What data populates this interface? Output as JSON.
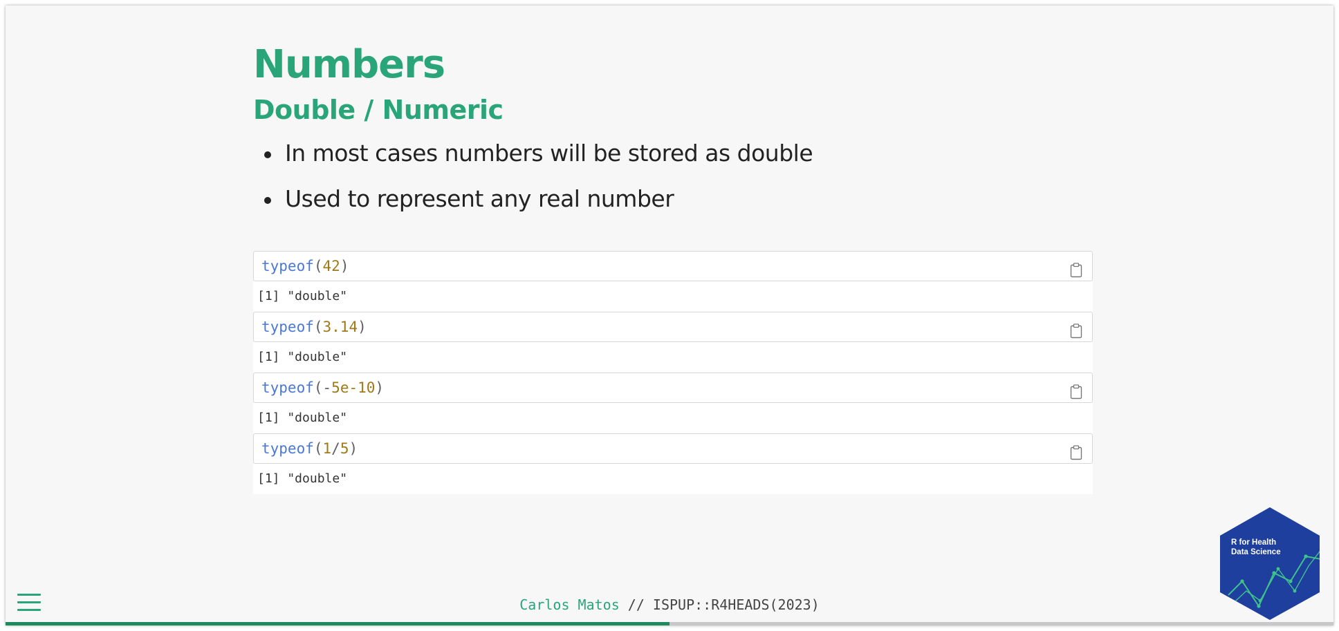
{
  "slide": {
    "title": "Numbers",
    "subtitle": "Double / Numeric",
    "bullets": [
      "In most cases numbers will be stored as double",
      "Used to represent any real number"
    ]
  },
  "code_blocks": [
    {
      "tokens": [
        {
          "type": "fn",
          "text": "typeof"
        },
        {
          "type": "op",
          "text": "("
        },
        {
          "type": "num",
          "text": "42"
        },
        {
          "type": "op",
          "text": ")"
        }
      ],
      "output": "[1] \"double\""
    },
    {
      "tokens": [
        {
          "type": "fn",
          "text": "typeof"
        },
        {
          "type": "op",
          "text": "("
        },
        {
          "type": "num",
          "text": "3.14"
        },
        {
          "type": "op",
          "text": ")"
        }
      ],
      "output": "[1] \"double\""
    },
    {
      "tokens": [
        {
          "type": "fn",
          "text": "typeof"
        },
        {
          "type": "op",
          "text": "("
        },
        {
          "type": "op",
          "text": "-"
        },
        {
          "type": "num",
          "text": "5e-10"
        },
        {
          "type": "op",
          "text": ")"
        }
      ],
      "output": "[1] \"double\""
    },
    {
      "tokens": [
        {
          "type": "fn",
          "text": "typeof"
        },
        {
          "type": "op",
          "text": "("
        },
        {
          "type": "num",
          "text": "1"
        },
        {
          "type": "op",
          "text": "/"
        },
        {
          "type": "num",
          "text": "5"
        },
        {
          "type": "op",
          "text": ")"
        }
      ],
      "output": "[1] \"double\""
    }
  ],
  "copy_icon": "clipboard-icon",
  "logo": {
    "line1": "R for Health",
    "line2": "Data Science",
    "color": "#1f3f9e"
  },
  "footer": {
    "author": "Carlos Matos",
    "separator": " // ",
    "course": "ISPUP::R4HEADS(2023)"
  },
  "menu_icon": "hamburger-menu-icon",
  "progress": 0.5,
  "colors": {
    "accent": "#2aa57a",
    "function": "#4a78d6",
    "number": "#a07817"
  }
}
